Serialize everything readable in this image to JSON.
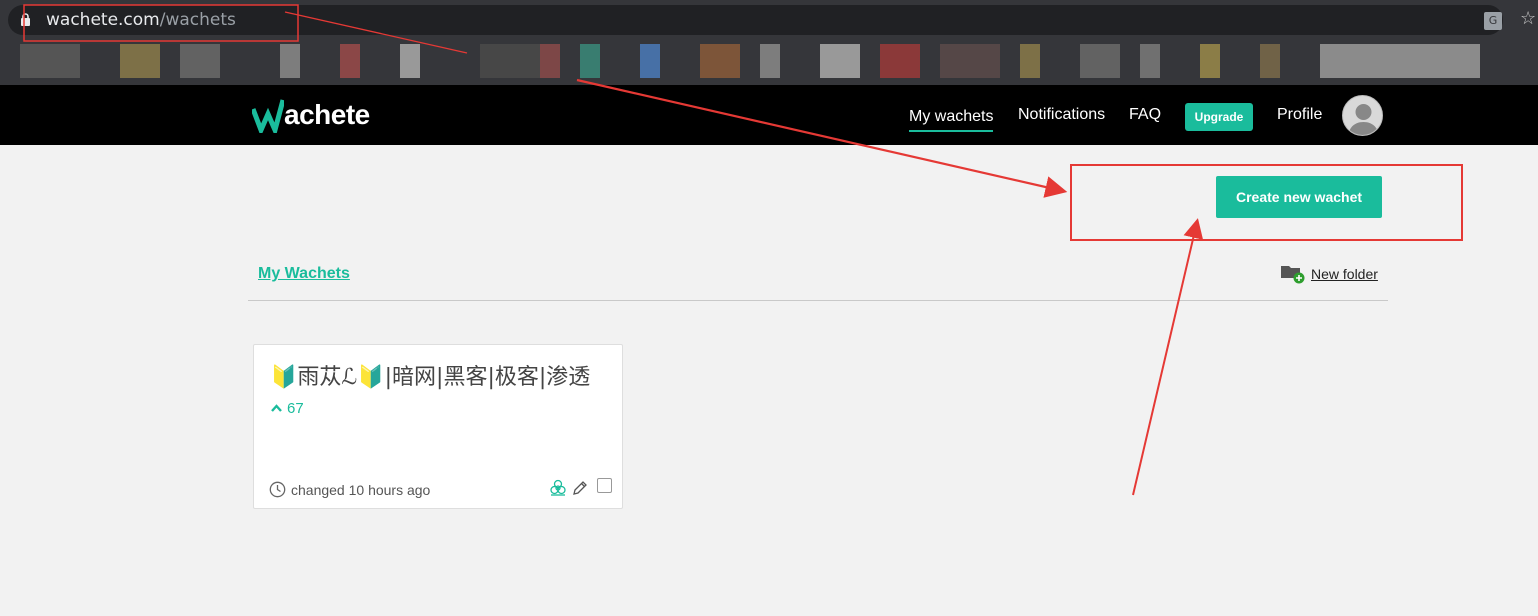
{
  "browser": {
    "url_host": "wachete.com",
    "url_path": "/wachets"
  },
  "header": {
    "brand": "achete",
    "nav": [
      "My wachets",
      "Notifications",
      "FAQ"
    ],
    "upgrade_label": "Upgrade",
    "profile_label": "Profile"
  },
  "main": {
    "create_button_label": "Create new wachet",
    "section_title": "My Wachets",
    "new_folder_label": "New folder",
    "cards": [
      {
        "title": "🔰雨苁ℒ🔰|暗网|黑客|极客|渗透",
        "count": "67",
        "changed": "changed 10 hours ago"
      }
    ]
  },
  "colors": {
    "accent": "#1abc9c",
    "annotation": "#e53935"
  }
}
